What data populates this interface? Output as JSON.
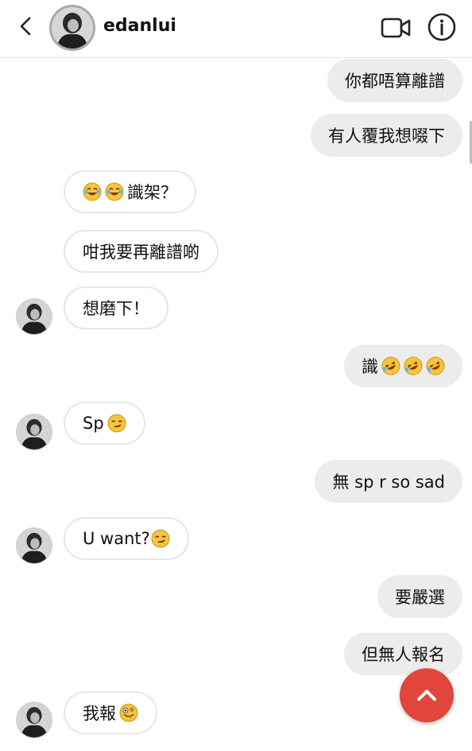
{
  "header": {
    "username": "edanlui",
    "back_icon": "chevron-left-icon",
    "video_icon": "video-camera-icon",
    "info_icon": "info-icon"
  },
  "messages": [
    {
      "dir": "out",
      "text": "你都唔算離譜",
      "emoji": []
    },
    {
      "dir": "out",
      "text": "有人覆我想啜下",
      "emoji": []
    },
    {
      "dir": "in",
      "text": "識架？",
      "emoji_before": [
        "laughing-tears",
        "laughing-tears"
      ]
    },
    {
      "dir": "in",
      "text": "咁我要再離譜啲",
      "emoji": []
    },
    {
      "dir": "in",
      "text": "想磨下！",
      "emoji": []
    },
    {
      "dir": "out",
      "text": "識",
      "emoji": [
        "rofl",
        "rofl",
        "rofl"
      ]
    },
    {
      "dir": "in",
      "text": "Sp",
      "emoji": [
        "smirk"
      ]
    },
    {
      "dir": "out",
      "text": "無 sp r so sad",
      "emoji": []
    },
    {
      "dir": "in",
      "text": "U want?",
      "emoji": [
        "smirk"
      ]
    },
    {
      "dir": "out",
      "text": "要嚴選",
      "emoji": []
    },
    {
      "dir": "out",
      "text": "但無人報名",
      "emoji": []
    },
    {
      "dir": "in",
      "text": "我報",
      "emoji": [
        "zany-face"
      ]
    }
  ],
  "scroll_button": {
    "icon": "chevron-up-icon",
    "color": "#e0463b"
  },
  "colors": {
    "outgoing_bubble": "#ececec",
    "incoming_bubble": "#ffffff"
  }
}
